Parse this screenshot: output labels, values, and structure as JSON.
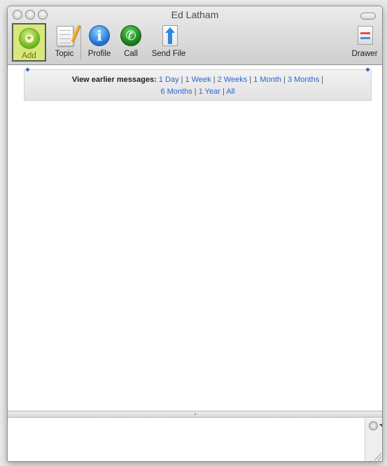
{
  "window": {
    "title": "Ed Latham"
  },
  "toolbar": {
    "add_label": "Add",
    "topic_label": "Topic",
    "profile_label": "Profile",
    "call_label": "Call",
    "send_file_label": "Send File",
    "drawer_label": "Drawer",
    "add_icon": "add-contact-icon",
    "topic_icon": "notepad-pencil-icon",
    "profile_icon": "info-icon",
    "call_icon": "phone-icon",
    "send_file_icon": "file-upload-icon",
    "drawer_icon": "drawer-icon"
  },
  "history": {
    "prefix": "View earlier messages:",
    "options": [
      "1 Day",
      "1 Week",
      "2 Weeks",
      "1 Month",
      "3 Months",
      "6 Months",
      "1 Year",
      "All"
    ],
    "link_color": "#2c63d3"
  },
  "input": {
    "value": "",
    "emoticon_icon": "smiley-icon"
  },
  "colors": {
    "add_highlight": "#d9e87a",
    "profile_blue": "#1d6fd1",
    "call_green": "#137a17"
  }
}
